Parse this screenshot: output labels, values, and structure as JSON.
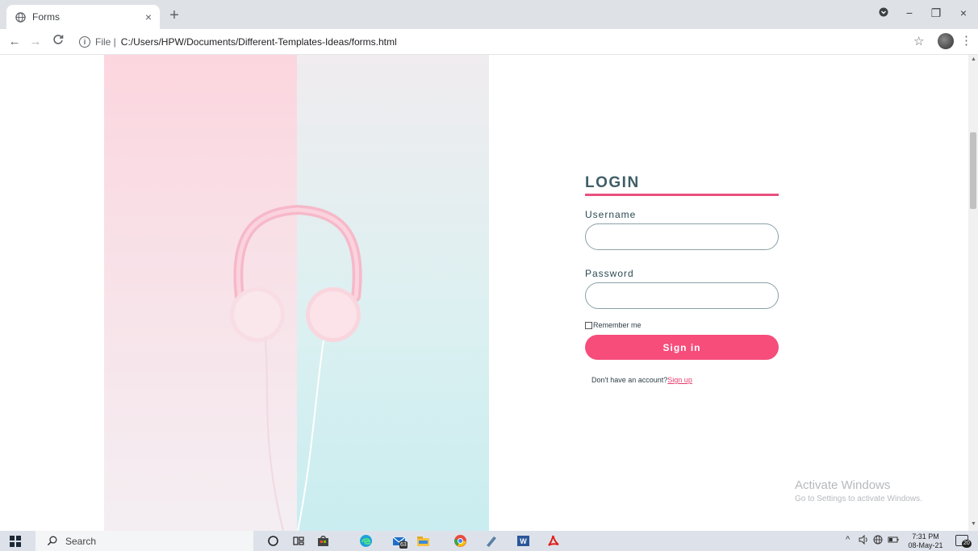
{
  "browser": {
    "tab": {
      "title": "Forms",
      "close": "×"
    },
    "new_tab": "+",
    "window_controls": {
      "minimize": "−",
      "maximize": "❐",
      "close": "×"
    },
    "nav": {
      "back": "←",
      "forward": "→",
      "reload": "C"
    },
    "address": {
      "info_glyph": "i",
      "prefix": "File |",
      "url": "C:/Users/HPW/Documents/Different-Templates-Ideas/forms.html"
    },
    "star": "☆",
    "menu": "⋮"
  },
  "login": {
    "title": "LOGIN",
    "username_label": "Username",
    "username_value": "",
    "password_label": "Password",
    "password_value": "",
    "remember_label": "Remember me",
    "remember_checked": false,
    "signin_label": "Sign in",
    "signup_prompt": "Don't have an account?",
    "signup_link": "Sign up"
  },
  "watermark": {
    "title": "Activate Windows",
    "subtitle": "Go to Settings to activate Windows."
  },
  "taskbar": {
    "search_label": "Search",
    "mail_badge": "63",
    "clock_time": "7:31 PM",
    "clock_date": "08-May-21",
    "notification_count": "20"
  },
  "colors": {
    "accent": "#f64d7b",
    "underline": "#ea4f7f",
    "title": "#3f5e66",
    "link": "#e53b6c"
  },
  "icons": {
    "tab": "globe-icon",
    "address_info": "info-icon",
    "start": "windows-logo-icon",
    "search": "search-icon",
    "cortana": "cortana-icon",
    "task_view": "task-view-icon",
    "store": "store-icon",
    "edge": "edge-icon",
    "mail": "mail-icon",
    "file_explorer": "file-explorer-icon",
    "chrome": "chrome-icon",
    "notes": "notes-icon",
    "word": "word-icon",
    "acrobat": "acrobat-icon"
  }
}
